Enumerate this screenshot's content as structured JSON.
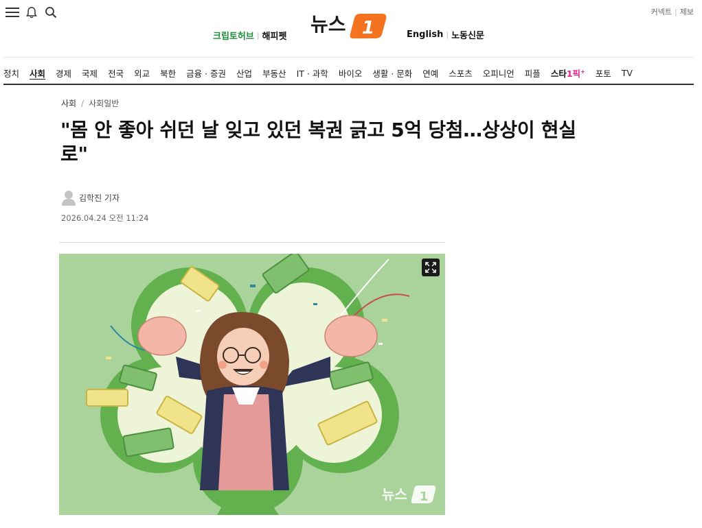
{
  "header": {
    "logo_text": "뉴스",
    "logo_mark": "1",
    "sub_left": [
      "크립토허브",
      "해피펫"
    ],
    "sub_right": [
      "English",
      "노동신문"
    ],
    "util": [
      "커넥트",
      "제보"
    ],
    "icons": [
      "menu-icon",
      "bell-icon",
      "search-icon"
    ]
  },
  "nav": {
    "items": [
      "정치",
      "사회",
      "경제",
      "국제",
      "전국",
      "외교",
      "북한",
      "금융 · 증권",
      "산업",
      "부동산",
      "IT · 과학",
      "바이오",
      "생활 · 문화",
      "연예",
      "스포츠",
      "오피니언",
      "피플"
    ],
    "active": "사회",
    "star_main": "스타",
    "star_pick": "1픽",
    "star_sup": "+",
    "tail": [
      "포토",
      "TV"
    ]
  },
  "article": {
    "breadcrumb": [
      "사회",
      "사회일반"
    ],
    "title_line1": "\"몸 안 좋아 쉬던 날 잊고 있던 복권 긁고 5억 당첨…상상이 현실",
    "title_line2": "로\"",
    "author": "김학진 기자",
    "date": "2026.04.24 오전 11:24"
  },
  "image": {
    "background_color": "#a9d39a",
    "watermark_text": "뉴스",
    "watermark_mark": "1",
    "expand_icon": "expand-icon"
  },
  "colors": {
    "brand_orange": "#f47320",
    "green_link": "#1d8e3a",
    "accent_pink": "#e6238b"
  }
}
